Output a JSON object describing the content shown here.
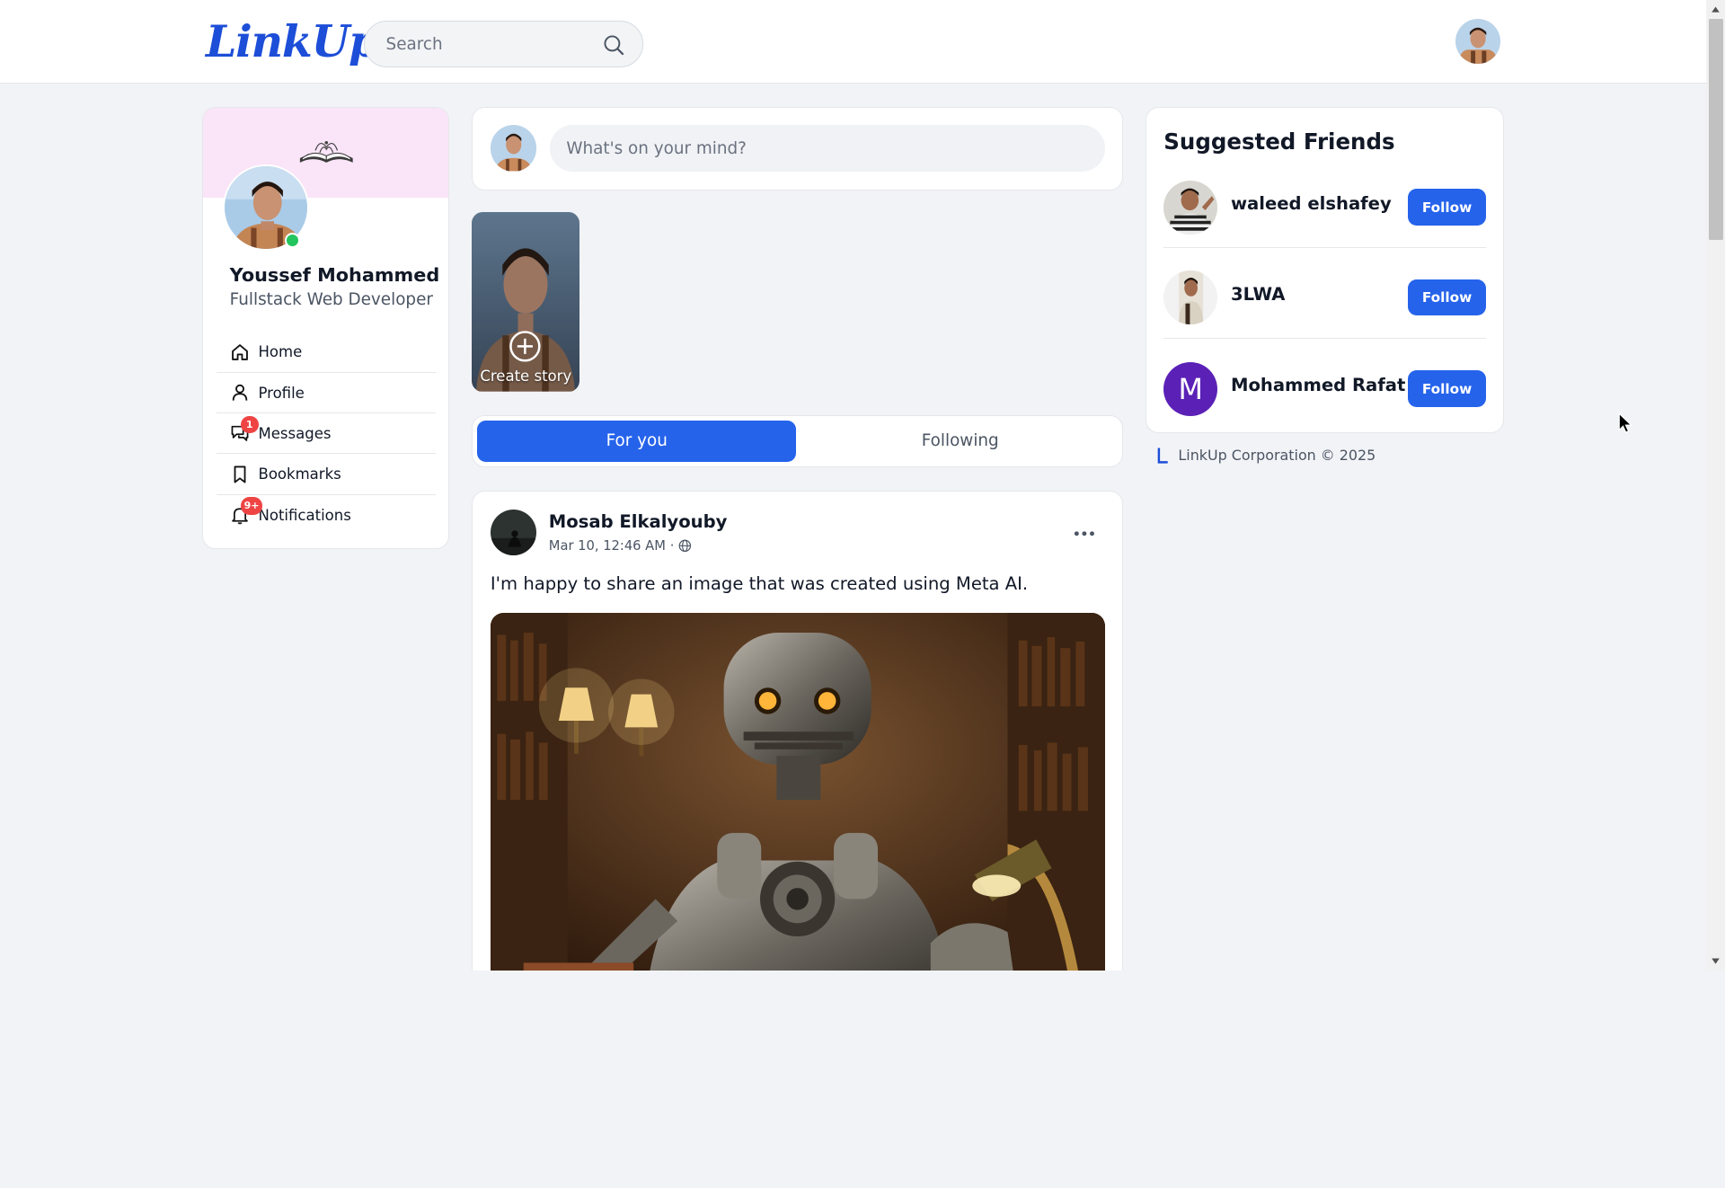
{
  "brand": {
    "logo_text": "LinkUp"
  },
  "search": {
    "placeholder": "Search"
  },
  "profile": {
    "name": "Youssef Mohammed",
    "role": "Fullstack Web Developer",
    "status": "online"
  },
  "nav": {
    "items": [
      {
        "label": "Home",
        "icon": "home-icon"
      },
      {
        "label": "Profile",
        "icon": "user-icon"
      },
      {
        "label": "Messages",
        "icon": "messages-icon",
        "badge": "1"
      },
      {
        "label": "Bookmarks",
        "icon": "bookmark-icon"
      },
      {
        "label": "Notifications",
        "icon": "bell-icon",
        "badge": "9+"
      }
    ]
  },
  "composer": {
    "placeholder": "What's on your mind?"
  },
  "story": {
    "label": "Create story"
  },
  "feed_tabs": {
    "for_you": "For you",
    "following": "Following"
  },
  "post": {
    "author": "Mosab Elkalyouby",
    "timestamp": "Mar 10, 12:46 AM",
    "separator": "·",
    "visibility": "public",
    "text": "I'm happy to share an image that was created using Meta AI."
  },
  "suggested": {
    "title": "Suggested Friends",
    "follow_label": "Follow",
    "friends": [
      {
        "name": "waleed elshafey"
      },
      {
        "name": "3LWA"
      },
      {
        "name": "Mohammed Rafat",
        "initial": "M"
      }
    ]
  },
  "footer": {
    "text": "LinkUp Corporation © 2025"
  },
  "colors": {
    "accent": "#2563eb",
    "badge": "#ef4444",
    "online": "#22c55e",
    "cover": "#f9e4f8"
  }
}
